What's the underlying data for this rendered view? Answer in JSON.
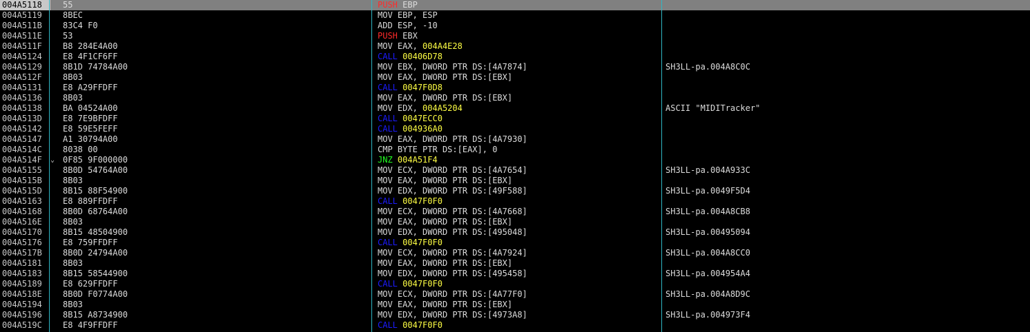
{
  "colors": {
    "push": "#ff2a2a",
    "call": "#1c1cff",
    "jnz": "#22ff22",
    "address_operand": "#ffff44",
    "column_separator": "#2fb7c4",
    "selection": "#808080"
  },
  "rows": [
    {
      "addr": "004A5118",
      "jmp": "",
      "bytes": "55",
      "mnem": "PUSH",
      "mtype": "push",
      "ops": [
        {
          "t": "EBP",
          "c": "plain"
        }
      ],
      "comment": "",
      "selected": true
    },
    {
      "addr": "004A5119",
      "jmp": "",
      "bytes": "8BEC",
      "mnem": "MOV",
      "mtype": "plain",
      "ops": [
        {
          "t": "EBP, ESP",
          "c": "plain"
        }
      ],
      "comment": ""
    },
    {
      "addr": "004A511B",
      "jmp": "",
      "bytes": "83C4 F0",
      "mnem": "ADD",
      "mtype": "plain",
      "ops": [
        {
          "t": "ESP, -10",
          "c": "plain"
        }
      ],
      "comment": ""
    },
    {
      "addr": "004A511E",
      "jmp": "",
      "bytes": "53",
      "mnem": "PUSH",
      "mtype": "push",
      "ops": [
        {
          "t": "EBX",
          "c": "plain"
        }
      ],
      "comment": ""
    },
    {
      "addr": "004A511F",
      "jmp": "",
      "bytes": "B8 284E4A00",
      "mnem": "MOV",
      "mtype": "plain",
      "ops": [
        {
          "t": "EAX, ",
          "c": "plain"
        },
        {
          "t": "004A4E28",
          "c": "addr"
        }
      ],
      "comment": ""
    },
    {
      "addr": "004A5124",
      "jmp": "",
      "bytes": "E8 4F1CF6FF",
      "mnem": "CALL",
      "mtype": "call",
      "ops": [
        {
          "t": "00406D78",
          "c": "addr"
        }
      ],
      "comment": ""
    },
    {
      "addr": "004A5129",
      "jmp": "",
      "bytes": "8B1D 74784A00",
      "mnem": "MOV",
      "mtype": "plain",
      "ops": [
        {
          "t": "EBX, DWORD PTR DS:[4A7874]",
          "c": "plain"
        }
      ],
      "comment": "SH3LL-pa.004A8C0C"
    },
    {
      "addr": "004A512F",
      "jmp": "",
      "bytes": "8B03",
      "mnem": "MOV",
      "mtype": "plain",
      "ops": [
        {
          "t": "EAX, DWORD PTR DS:[EBX]",
          "c": "plain"
        }
      ],
      "comment": ""
    },
    {
      "addr": "004A5131",
      "jmp": "",
      "bytes": "E8 A29FFDFF",
      "mnem": "CALL",
      "mtype": "call",
      "ops": [
        {
          "t": "0047F0D8",
          "c": "addr"
        }
      ],
      "comment": ""
    },
    {
      "addr": "004A5136",
      "jmp": "",
      "bytes": "8B03",
      "mnem": "MOV",
      "mtype": "plain",
      "ops": [
        {
          "t": "EAX, DWORD PTR DS:[EBX]",
          "c": "plain"
        }
      ],
      "comment": ""
    },
    {
      "addr": "004A5138",
      "jmp": "",
      "bytes": "BA 04524A00",
      "mnem": "MOV",
      "mtype": "plain",
      "ops": [
        {
          "t": "EDX, ",
          "c": "plain"
        },
        {
          "t": "004A5204",
          "c": "addr"
        }
      ],
      "comment": "ASCII \"MIDITracker\""
    },
    {
      "addr": "004A513D",
      "jmp": "",
      "bytes": "E8 7E9BFDFF",
      "mnem": "CALL",
      "mtype": "call",
      "ops": [
        {
          "t": "0047ECC0",
          "c": "addr"
        }
      ],
      "comment": ""
    },
    {
      "addr": "004A5142",
      "jmp": "",
      "bytes": "E8 59E5FEFF",
      "mnem": "CALL",
      "mtype": "call",
      "ops": [
        {
          "t": "004936A0",
          "c": "addr"
        }
      ],
      "comment": ""
    },
    {
      "addr": "004A5147",
      "jmp": "",
      "bytes": "A1 30794A00",
      "mnem": "MOV",
      "mtype": "plain",
      "ops": [
        {
          "t": "EAX, DWORD PTR DS:[4A7930]",
          "c": "plain"
        }
      ],
      "comment": ""
    },
    {
      "addr": "004A514C",
      "jmp": "",
      "bytes": "8038 00",
      "mnem": "CMP",
      "mtype": "plain",
      "ops": [
        {
          "t": "BYTE PTR DS:[EAX], 0",
          "c": "plain"
        }
      ],
      "comment": ""
    },
    {
      "addr": "004A514F",
      "jmp": "⌄",
      "bytes": "0F85 9F000000",
      "mnem": "JNZ",
      "mtype": "jnz",
      "ops": [
        {
          "t": "004A51F4",
          "c": "addr"
        }
      ],
      "comment": ""
    },
    {
      "addr": "004A5155",
      "jmp": "",
      "bytes": "8B0D 54764A00",
      "mnem": "MOV",
      "mtype": "plain",
      "ops": [
        {
          "t": "ECX, DWORD PTR DS:[4A7654]",
          "c": "plain"
        }
      ],
      "comment": "SH3LL-pa.004A933C"
    },
    {
      "addr": "004A515B",
      "jmp": "",
      "bytes": "8B03",
      "mnem": "MOV",
      "mtype": "plain",
      "ops": [
        {
          "t": "EAX, DWORD PTR DS:[EBX]",
          "c": "plain"
        }
      ],
      "comment": ""
    },
    {
      "addr": "004A515D",
      "jmp": "",
      "bytes": "8B15 88F54900",
      "mnem": "MOV",
      "mtype": "plain",
      "ops": [
        {
          "t": "EDX, DWORD PTR DS:[49F588]",
          "c": "plain"
        }
      ],
      "comment": "SH3LL-pa.0049F5D4"
    },
    {
      "addr": "004A5163",
      "jmp": "",
      "bytes": "E8 889FFDFF",
      "mnem": "CALL",
      "mtype": "call",
      "ops": [
        {
          "t": "0047F0F0",
          "c": "addr"
        }
      ],
      "comment": ""
    },
    {
      "addr": "004A5168",
      "jmp": "",
      "bytes": "8B0D 68764A00",
      "mnem": "MOV",
      "mtype": "plain",
      "ops": [
        {
          "t": "ECX, DWORD PTR DS:[4A7668]",
          "c": "plain"
        }
      ],
      "comment": "SH3LL-pa.004A8CB8"
    },
    {
      "addr": "004A516E",
      "jmp": "",
      "bytes": "8B03",
      "mnem": "MOV",
      "mtype": "plain",
      "ops": [
        {
          "t": "EAX, DWORD PTR DS:[EBX]",
          "c": "plain"
        }
      ],
      "comment": ""
    },
    {
      "addr": "004A5170",
      "jmp": "",
      "bytes": "8B15 48504900",
      "mnem": "MOV",
      "mtype": "plain",
      "ops": [
        {
          "t": "EDX, DWORD PTR DS:[495048]",
          "c": "plain"
        }
      ],
      "comment": "SH3LL-pa.00495094"
    },
    {
      "addr": "004A5176",
      "jmp": "",
      "bytes": "E8 759FFDFF",
      "mnem": "CALL",
      "mtype": "call",
      "ops": [
        {
          "t": "0047F0F0",
          "c": "addr"
        }
      ],
      "comment": ""
    },
    {
      "addr": "004A517B",
      "jmp": "",
      "bytes": "8B0D 24794A00",
      "mnem": "MOV",
      "mtype": "plain",
      "ops": [
        {
          "t": "ECX, DWORD PTR DS:[4A7924]",
          "c": "plain"
        }
      ],
      "comment": "SH3LL-pa.004A8CC0"
    },
    {
      "addr": "004A5181",
      "jmp": "",
      "bytes": "8B03",
      "mnem": "MOV",
      "mtype": "plain",
      "ops": [
        {
          "t": "EAX, DWORD PTR DS:[EBX]",
          "c": "plain"
        }
      ],
      "comment": ""
    },
    {
      "addr": "004A5183",
      "jmp": "",
      "bytes": "8B15 58544900",
      "mnem": "MOV",
      "mtype": "plain",
      "ops": [
        {
          "t": "EDX, DWORD PTR DS:[495458]",
          "c": "plain"
        }
      ],
      "comment": "SH3LL-pa.004954A4"
    },
    {
      "addr": "004A5189",
      "jmp": "",
      "bytes": "E8 629FFDFF",
      "mnem": "CALL",
      "mtype": "call",
      "ops": [
        {
          "t": "0047F0F0",
          "c": "addr"
        }
      ],
      "comment": ""
    },
    {
      "addr": "004A518E",
      "jmp": "",
      "bytes": "8B0D F0774A00",
      "mnem": "MOV",
      "mtype": "plain",
      "ops": [
        {
          "t": "ECX, DWORD PTR DS:[4A77F0]",
          "c": "plain"
        }
      ],
      "comment": "SH3LL-pa.004A8D9C"
    },
    {
      "addr": "004A5194",
      "jmp": "",
      "bytes": "8B03",
      "mnem": "MOV",
      "mtype": "plain",
      "ops": [
        {
          "t": "EAX, DWORD PTR DS:[EBX]",
          "c": "plain"
        }
      ],
      "comment": ""
    },
    {
      "addr": "004A5196",
      "jmp": "",
      "bytes": "8B15 A8734900",
      "mnem": "MOV",
      "mtype": "plain",
      "ops": [
        {
          "t": "EDX, DWORD PTR DS:[4973A8]",
          "c": "plain"
        }
      ],
      "comment": "SH3LL-pa.004973F4"
    },
    {
      "addr": "004A519C",
      "jmp": "",
      "bytes": "E8 4F9FFDFF",
      "mnem": "CALL",
      "mtype": "call",
      "ops": [
        {
          "t": "0047F0F0",
          "c": "addr"
        }
      ],
      "comment": ""
    }
  ]
}
